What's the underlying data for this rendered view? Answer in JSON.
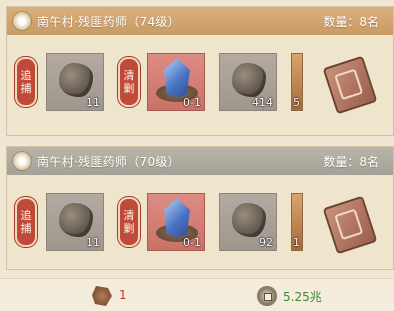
{
  "tasks": [
    {
      "title": "南午村·残匪药师（74级）",
      "count": "数量：8名",
      "tag_left": [
        "追",
        "捕"
      ],
      "tag_mid": [
        "清",
        "剿"
      ],
      "items": [
        {
          "icon": "ore-rock-icon",
          "qty": "11"
        },
        {
          "icon": "blue-crystal-icon",
          "qty": "0-1"
        },
        {
          "icon": "ore-rock-icon",
          "qty": "414"
        },
        {
          "icon": "partial-item-icon",
          "qty": "5"
        }
      ],
      "reward_icon": "scroll-icon"
    },
    {
      "title": "南午村·残匪药师（70级）",
      "count": "数量：8名",
      "tag_left": [
        "追",
        "捕"
      ],
      "tag_mid": [
        "清",
        "剿"
      ],
      "items": [
        {
          "icon": "ore-rock-icon",
          "qty": "11"
        },
        {
          "icon": "blue-crystal-icon",
          "qty": "0-1"
        },
        {
          "icon": "ore-rock-icon",
          "qty": "92"
        },
        {
          "icon": "partial-item-icon",
          "qty": "1"
        }
      ],
      "reward_icon": "scroll-icon"
    }
  ],
  "footer": {
    "stamina_icon": "creature-icon",
    "stamina_value": "1",
    "coin_icon": "coin-icon",
    "coin_value": "5.25兆"
  },
  "colors": {
    "header_active": "#c99a64",
    "header_inactive": "#a4a296",
    "tag_red": "#c04a3a",
    "value_red": "#c0392b",
    "value_green": "#3c8a2f"
  }
}
